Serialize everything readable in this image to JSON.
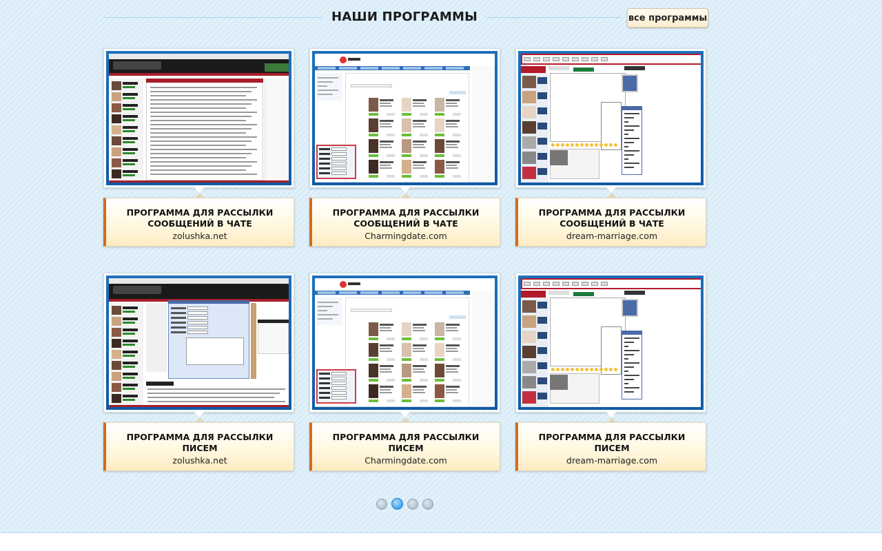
{
  "header": {
    "title": "НАШИ ПРОГРАММЫ",
    "all_button": "все программы"
  },
  "cards": [
    {
      "title1": "ПРОГРАММА ДЛЯ РАССЫЛКИ",
      "title2": "СООБЩЕНИЙ В ЧАТЕ",
      "site": "zolushka.net",
      "thumb_style": "zolushka-chat"
    },
    {
      "title1": "ПРОГРАММА ДЛЯ РАССЫЛКИ",
      "title2": "СООБЩЕНИЙ В ЧАТЕ",
      "site": "Charmingdate.com",
      "thumb_style": "charming"
    },
    {
      "title1": "ПРОГРАММА ДЛЯ РАССЫЛКИ",
      "title2": "СООБЩЕНИЙ В ЧАТЕ",
      "site": "dream-marriage.com",
      "thumb_style": "dream"
    },
    {
      "title1": "ПРОГРАММА ДЛЯ РАССЫЛКИ",
      "title2": "ПИСЕМ",
      "site": "zolushka.net",
      "thumb_style": "zolushka-mail"
    },
    {
      "title1": "ПРОГРАММА ДЛЯ РАССЫЛКИ",
      "title2": "ПИСЕМ",
      "site": "Charmingdate.com",
      "thumb_style": "charming"
    },
    {
      "title1": "ПРОГРАММА ДЛЯ РАССЫЛКИ",
      "title2": "ПИСЕМ",
      "site": "dream-marriage.com",
      "thumb_style": "dream"
    }
  ],
  "pager": {
    "pages": 4,
    "active": 1
  },
  "colors": {
    "accent": "#d46a1f",
    "frame": "#1d6fbd",
    "active_dot": "#1f8fe0"
  }
}
